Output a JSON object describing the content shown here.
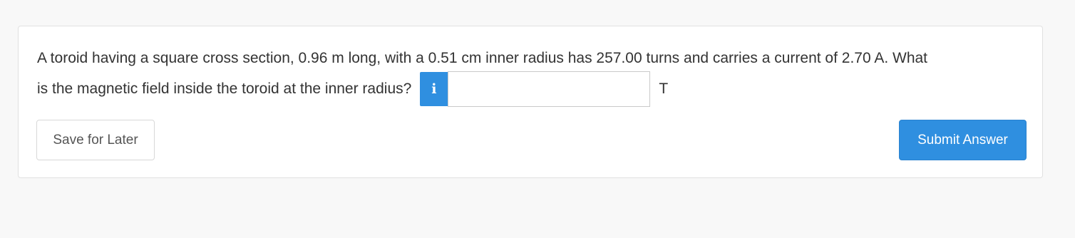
{
  "question": {
    "line1": "A toroid having a square cross section, 0.96 m long, with a 0.51 cm inner radius has 257.00 turns and carries a current of 2.70 A. What",
    "line2": "is the magnetic field inside the toroid at the inner radius?"
  },
  "answer": {
    "info_icon": "i",
    "value": "",
    "placeholder": "",
    "unit": "T"
  },
  "actions": {
    "save_label": "Save for Later",
    "submit_label": "Submit Answer"
  },
  "colors": {
    "accent": "#2f8fe0",
    "text": "#333333",
    "background": "#f8f8f8"
  }
}
